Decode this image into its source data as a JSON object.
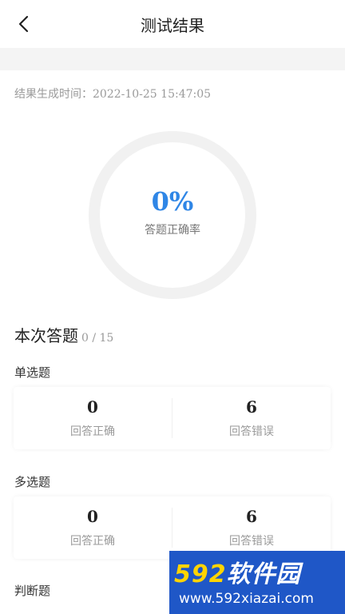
{
  "header": {
    "title": "测试结果"
  },
  "result": {
    "generated_label": "结果生成时间：",
    "generated_time": "2022-10-25 15:47:05",
    "accuracy_value": "0%",
    "accuracy_fraction": 0,
    "accuracy_label": "答题正确率"
  },
  "summary": {
    "title": "本次答题",
    "count": "0 / 15"
  },
  "groups": [
    {
      "label": "单选题",
      "correct": "0",
      "correct_label": "回答正确",
      "wrong": "6",
      "wrong_label": "回答错误"
    },
    {
      "label": "多选题",
      "correct": "0",
      "correct_label": "回答正确",
      "wrong": "6",
      "wrong_label": "回答错误"
    },
    {
      "label": "判断题"
    }
  ],
  "watermark": {
    "brand_digits": "592",
    "brand_text": "软件园",
    "url": "www.592xiazai.com"
  },
  "colors": {
    "accent": "#2f86e6",
    "ring_track": "#f1f1f1",
    "watermark_bg": "#1f57c7"
  }
}
